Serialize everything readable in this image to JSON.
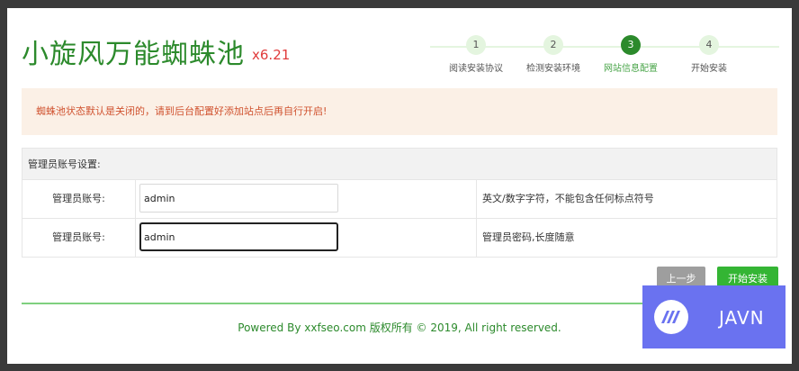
{
  "header": {
    "title": "小旋风万能蜘蛛池",
    "version": "x6.21"
  },
  "steps": [
    {
      "number": "1",
      "label": "阅读安装协议",
      "active": false
    },
    {
      "number": "2",
      "label": "检测安装环境",
      "active": false
    },
    {
      "number": "3",
      "label": "网站信息配置",
      "active": true
    },
    {
      "number": "4",
      "label": "开始安装",
      "active": false
    }
  ],
  "notice": "蜘蛛池状态默认是关闭的，请到后台配置好添加站点后再自行开启!",
  "form": {
    "section_title": "管理员账号设置:",
    "rows": [
      {
        "label": "管理员账号:",
        "value": "admin",
        "description": "英文/数字字符，不能包含任何标点符号"
      },
      {
        "label": "管理员账号:",
        "value": "admin",
        "description": "管理员密码,长度随意"
      }
    ]
  },
  "buttons": {
    "prev_label": "上一步",
    "start_label": "开始安装"
  },
  "footer": "Powered By xxfseo.com 版权所有 © 2019, All right reserved.",
  "watermark": {
    "text": "JAVN",
    "icon": "javn-logo-icon"
  },
  "colors": {
    "brand_green": "#2c8a2c",
    "version_red": "#e03b3b",
    "notice_bg": "#fbf0e6",
    "notice_text": "#d0522f",
    "start_button": "#34b534",
    "prev_button": "#9e9e9e",
    "watermark_bg": "#6a72f0"
  }
}
